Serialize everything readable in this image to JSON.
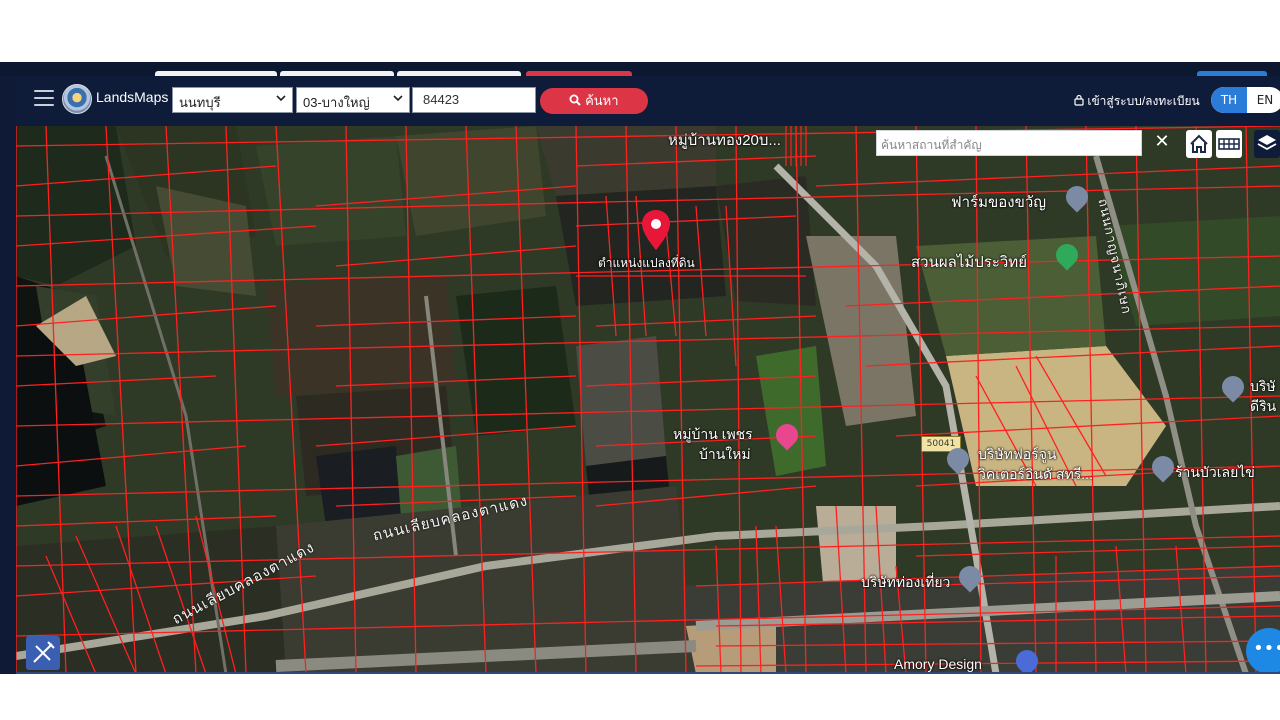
{
  "header": {
    "brand": "LandsMaps",
    "province": "นนทบุรี",
    "district": "03-บางใหญ่",
    "parcel_number": "84423",
    "search_label": "ค้นหา",
    "login_label": "เข้าสู่ระบบ/ลงทะเบียน",
    "lang_th": "TH",
    "lang_en": "EN",
    "active_lang": "TH"
  },
  "map": {
    "place_search_placeholder": "ค้นหาสถานที่สำคัญ",
    "close_symbol": "✕",
    "marker_label": "ตำแหน่งแปลงที่ดิน",
    "fab_label": "•••",
    "labels": {
      "top_village": "หมู่บ้านทอง20บ...",
      "farm": "ฟาร์มของขวัญ",
      "orchard": "สวนผลไม้ประวิทย์",
      "village_phet": "หมู่บ้าน เพชร",
      "ban_mai": "บ้านใหม่",
      "company_fortune": "บริษัทฟอร์จูน",
      "company_fortune_2": "วิคเตอร์อินดั สทรี...",
      "shop": "ร้านบัวเลยไข่",
      "company_right_1": "บริษั",
      "company_right_2": "ดีริน",
      "company_bottom": "บริษัทท่องเที่ยว",
      "amory": "Amory Design",
      "road_main": "ถนนเลียบคลองตาแดง",
      "road_left": "ถนนเลียบคลองตาแดง",
      "road_right": "ถนนกาญจนาภิเษก",
      "route_badge": "50041"
    },
    "colors": {
      "parcel_line": "#ff2020",
      "marker": "#e8173a",
      "header_bg": "#0f1c39",
      "search_btn": "#dc3545",
      "lang_active": "#2b7bd8",
      "fab": "#1e88e5"
    },
    "icons": [
      "hamburger-icon",
      "logo-seal",
      "chevron-down-icon",
      "search-icon",
      "lock-icon",
      "home-icon",
      "grid-icon",
      "layers-icon",
      "ruler-icon",
      "map-pin-icon",
      "more-icon"
    ]
  }
}
